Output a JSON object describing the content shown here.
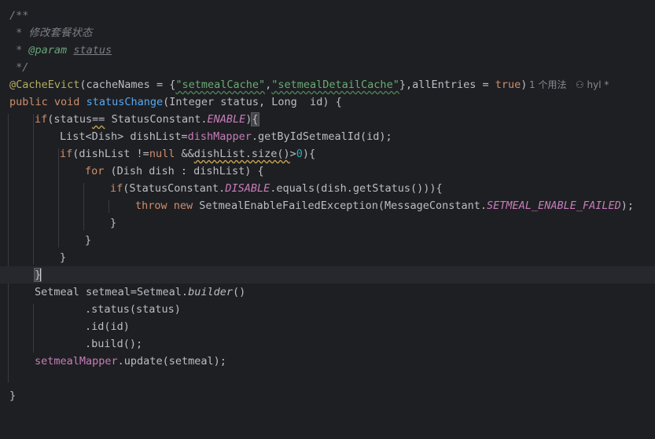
{
  "editor": {
    "doc_open": "/**",
    "doc_desc_star": " * ",
    "doc_desc": "修改套餐状态",
    "doc_param_star": " * ",
    "doc_param_tag": "@param",
    "doc_param_name": "status",
    "doc_close": " */",
    "ann_name": "@CacheEvict",
    "ann_open": "(cacheNames = {",
    "str1": "\"setmealCache\"",
    "comma": ",",
    "str2": "\"setmealDetailCache\"",
    "ann_mid": "},allEntries = ",
    "kw_true": "true",
    "ann_close": ")",
    "inlay_usages": "1 个用法",
    "inlay_author": "hyl *",
    "kw_public": "public",
    "kw_void": "void",
    "method_name": "statusChange",
    "sig_params": "(Integer status, Long  id) {",
    "kw_if": "if",
    "if_cond_a": "(status",
    "if_cond_op": "==",
    "if_cond_b": " StatusConstant.",
    "const_enable": "ENABLE",
    "if_close": ")",
    "brace_open": "{",
    "list_decl": "List<Dish> dishList=",
    "fld_dishMapper": "dishMapper",
    "list_call": ".getByIdSetmealId(id);",
    "kw_if2": "if",
    "if2_a": "(dishList !=",
    "kw_null": "null",
    "if2_b": " &&",
    "if2_warn": "dishList.size()",
    "if2_gt": ">",
    "num_zero": "0",
    "if2_c": "){",
    "kw_for": "for",
    "for_body": " (Dish dish : dishList) {",
    "kw_if3": "if",
    "if3_a": "(StatusConstant.",
    "const_disable": "DISABLE",
    "if3_b": ".equals(dish.getStatus())){",
    "kw_throw": "throw",
    "kw_new": "new",
    "throw_a": " SetmealEnableFailedException(MessageConstant.",
    "const_failed": "SETMEAL_ENABLE_FAILED",
    "throw_b": ");",
    "brace_close": "}",
    "builder_a": "Setmeal setmeal=Setmeal.",
    "builder_m": "builder",
    "builder_b": "()",
    "chain_status": ".status(status)",
    "chain_id": ".id(id)",
    "chain_build": ".build();",
    "fld_setmealMapper": "setmealMapper",
    "update_call": ".update(setmeal);"
  }
}
